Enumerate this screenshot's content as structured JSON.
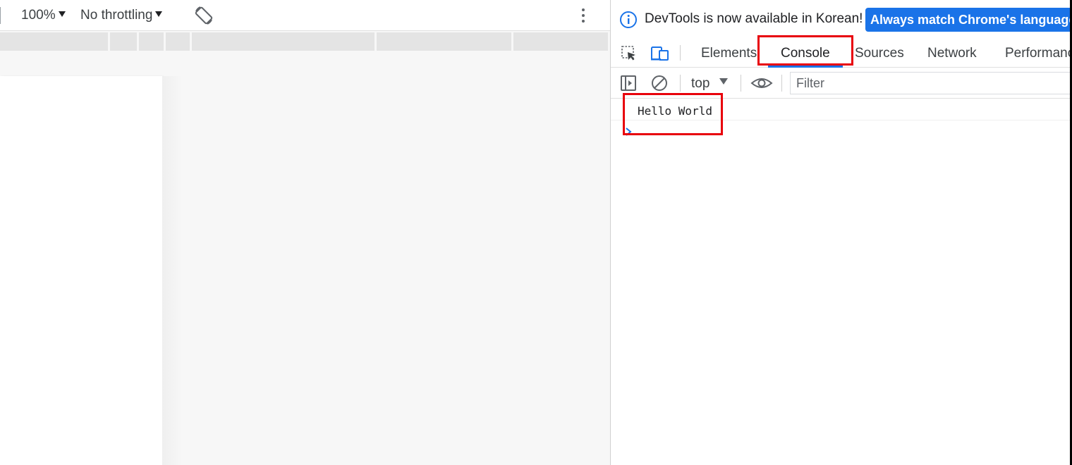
{
  "device_toolbar": {
    "zoom": "100%",
    "throttling": "No throttling",
    "icons": {
      "rotate": "rotate-icon",
      "more": "kebab-menu-icon"
    }
  },
  "devtools": {
    "infobar": {
      "message": "DevTools is now available in Korean!",
      "button_label": "Always match Chrome's language",
      "button_color": "#1a73e8",
      "icon": "info-icon"
    },
    "tabs": [
      {
        "label": "Elements",
        "active": false
      },
      {
        "label": "Console",
        "active": true
      },
      {
        "label": "Sources",
        "active": false
      },
      {
        "label": "Network",
        "active": false
      },
      {
        "label": "Performanc",
        "active": false
      }
    ],
    "tab_icons": {
      "inspect": "inspect-element-icon",
      "device": "device-toggle-icon"
    },
    "console_toolbar": {
      "context": "top",
      "filter_placeholder": "Filter",
      "icons": {
        "sidebar": "sidebar-toggle-icon",
        "clear": "clear-console-icon",
        "live_expression": "eye-icon"
      }
    },
    "console_messages": [
      {
        "text": "Hello World"
      }
    ]
  },
  "colors": {
    "accent": "#1a73e8",
    "highlight": "#e8000b"
  }
}
